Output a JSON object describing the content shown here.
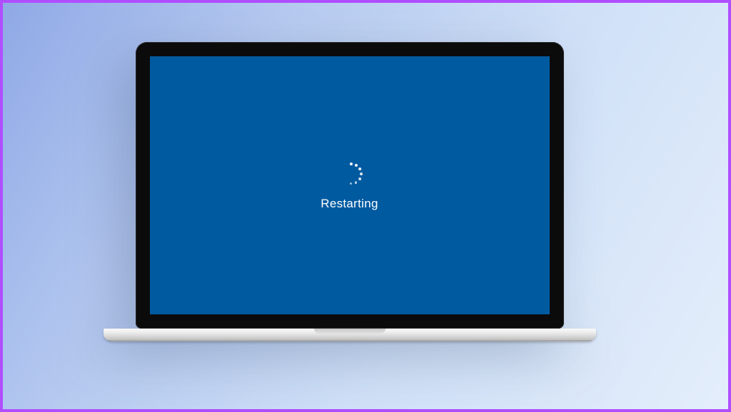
{
  "screen": {
    "status_text": "Restarting",
    "background_color": "#005aa0",
    "spinner_color": "#ffffff"
  },
  "frame": {
    "border_color": "#b04eff"
  }
}
